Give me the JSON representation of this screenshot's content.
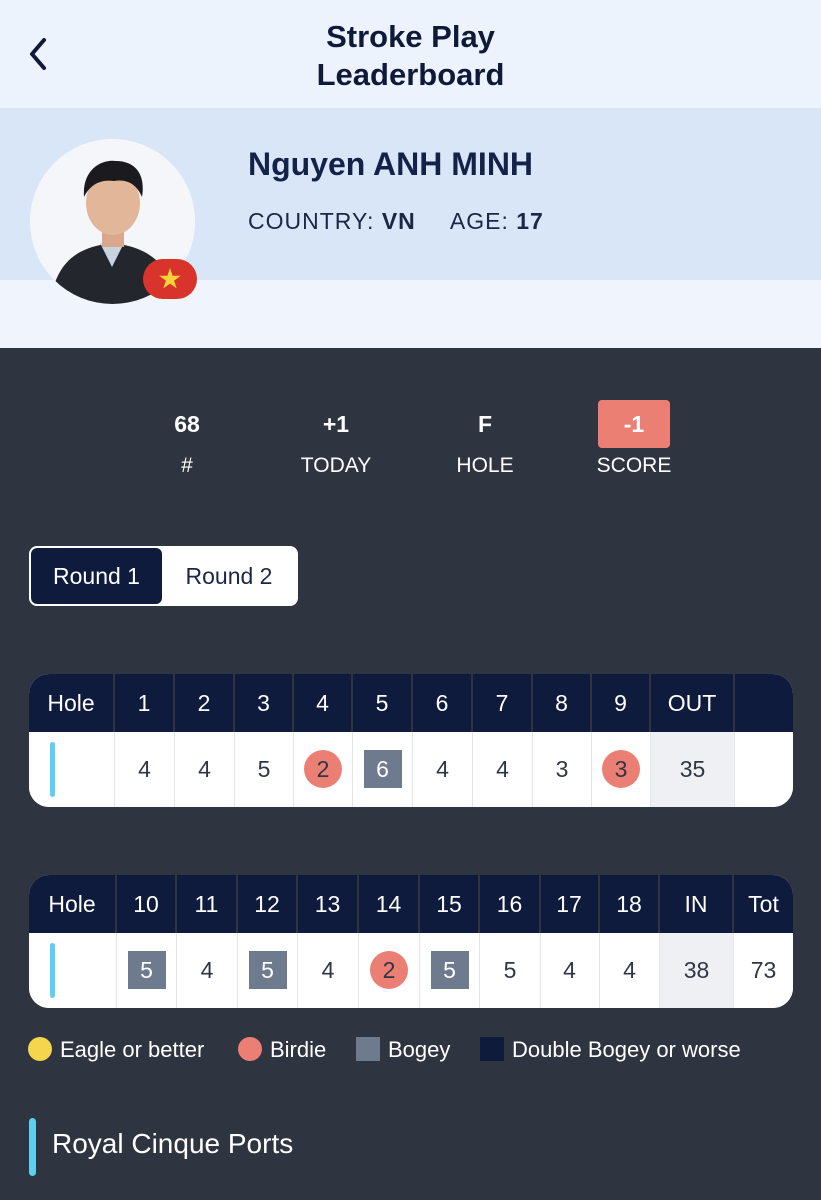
{
  "header": {
    "title_line1": "Stroke Play",
    "title_line2": "Leaderboard"
  },
  "player": {
    "name": "Nguyen ANH MINH",
    "country_label": "COUNTRY:",
    "country": "VN",
    "age_label": "AGE:",
    "age": "17"
  },
  "stats": [
    {
      "value": "68",
      "label": "#"
    },
    {
      "value": "+1",
      "label": "TODAY"
    },
    {
      "value": "F",
      "label": "HOLE"
    },
    {
      "value": "-1",
      "label": "SCORE"
    }
  ],
  "rounds": {
    "round1": "Round 1",
    "round2": "Round 2",
    "active": "Round 1"
  },
  "front_nine": {
    "header": [
      "Hole",
      "1",
      "2",
      "3",
      "4",
      "5",
      "6",
      "7",
      "8",
      "9",
      "OUT",
      ""
    ],
    "scores": [
      "4",
      "4",
      "5",
      "2",
      "6",
      "4",
      "4",
      "3",
      "3",
      "35",
      ""
    ],
    "types": [
      "par",
      "par",
      "par",
      "birdie",
      "bogey",
      "par",
      "par",
      "par",
      "birdie",
      "total",
      "empty"
    ]
  },
  "back_nine": {
    "header": [
      "Hole",
      "10",
      "11",
      "12",
      "13",
      "14",
      "15",
      "16",
      "17",
      "18",
      "IN",
      "Tot"
    ],
    "scores": [
      "5",
      "4",
      "5",
      "4",
      "2",
      "5",
      "5",
      "4",
      "4",
      "38",
      "73"
    ],
    "types": [
      "bogey",
      "par",
      "bogey",
      "par",
      "birdie",
      "bogey",
      "par",
      "par",
      "par",
      "total",
      "plain"
    ]
  },
  "legend": {
    "eagle": "Eagle or better",
    "birdie": "Birdie",
    "bogey": "Bogey",
    "double_bogey": "Double Bogey or worse"
  },
  "course": {
    "name": "Royal Cinque Ports"
  },
  "colors": {
    "navy": "#0f1b3c",
    "background": "#2f3441",
    "birdie": "#ec7f74",
    "bogey": "#6e7a8d",
    "eagle": "#f5d54b",
    "course_marker": "#5ecff0",
    "flag_red": "#d8342b",
    "flag_star": "#f7d23b"
  }
}
